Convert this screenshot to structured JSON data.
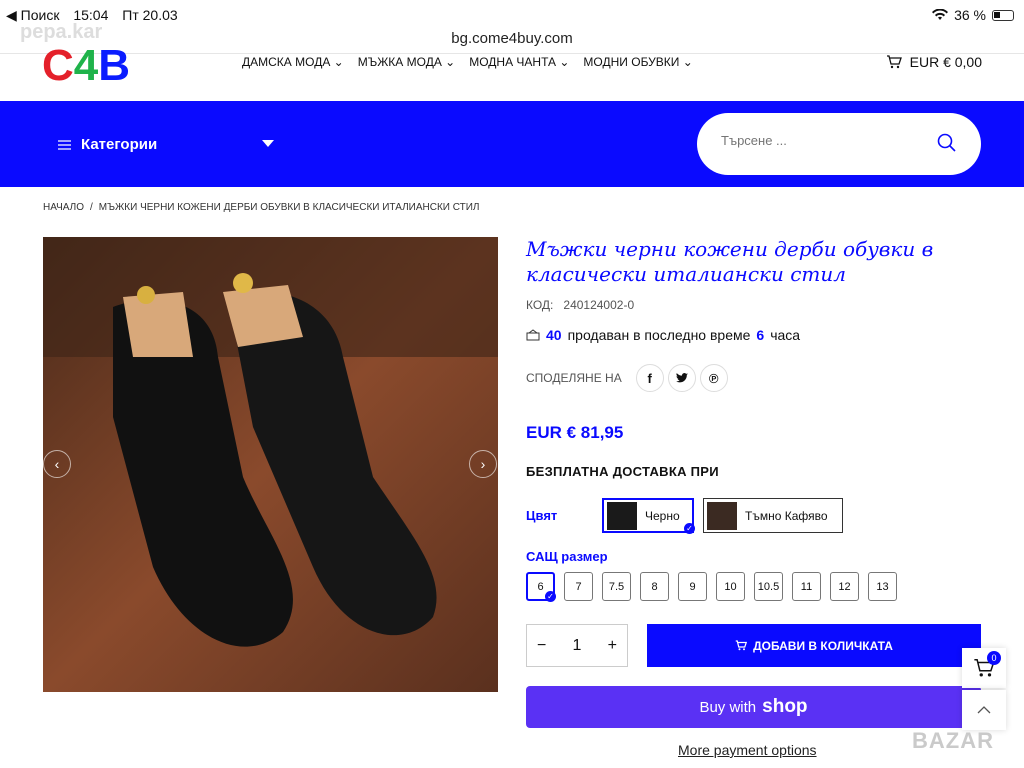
{
  "status_bar": {
    "back": "◀ Поиск",
    "time": "15:04",
    "date": "Пт 20.03",
    "battery": "36 %"
  },
  "browser": {
    "url": "bg.come4buy.com"
  },
  "header": {
    "logo_c": "C",
    "logo_4": "4",
    "logo_b": "B",
    "faded_text": "pepa.kar",
    "nav": [
      "ДАМСКА МОДА",
      "МЪЖКА МОДА",
      "МОДНА ЧАНТА",
      "МОДНИ ОБУВКИ"
    ],
    "cart_total": "EUR € 0,00"
  },
  "bluebar": {
    "categories_label": "Категории",
    "search_placeholder": "Търсене ..."
  },
  "breadcrumb": {
    "home": "НАЧАЛО",
    "separator": "/",
    "current": "МЪЖКИ ЧЕРНИ КОЖЕНИ ДЕРБИ ОБУВКИ В КЛАСИЧЕСКИ ИТАЛИАНСКИ СТИЛ"
  },
  "product": {
    "title": "Мъжки черни кожени дерби обувки в класически италиански стил",
    "code_label": "КОД:",
    "code": "240124002-0",
    "sold_count": "40",
    "sold_text": "продаван в последно време",
    "sold_hours": "6",
    "sold_unit": "часа",
    "share_label": "СПОДЕЛЯНЕ НА",
    "price": "EUR € 81,95",
    "shipping": "БЕЗПЛАТНА ДОСТАВКА ПРИ",
    "color_label": "Цвят",
    "colors": [
      "Черно",
      "Тъмно Кафяво"
    ],
    "size_label": "САЩ размер",
    "sizes": [
      "6",
      "7",
      "7.5",
      "8",
      "9",
      "10",
      "10.5",
      "11",
      "12",
      "13"
    ],
    "quantity": "1",
    "add_to_cart": "ДОБАВИ В КОЛИЧКАТА",
    "buy_with": "Buy with",
    "shop_brand": "shop",
    "more_options": "More payment options"
  },
  "floating": {
    "cart_count": "0"
  },
  "watermark": "BAZAR",
  "colors": {
    "brand_blue": "#0a0aff",
    "shop_purple": "#5a31f4"
  }
}
